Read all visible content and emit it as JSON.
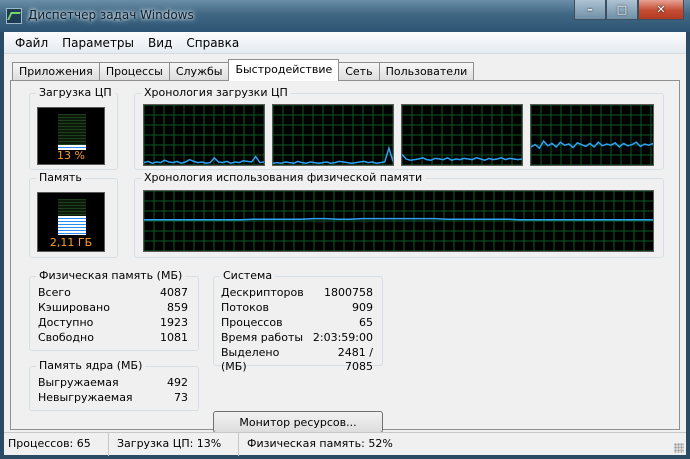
{
  "window": {
    "title": "Диспетчер задач Windows",
    "buttons": {
      "minimize": "–",
      "maximize": "□",
      "close": "✕"
    }
  },
  "menu": [
    "Файл",
    "Параметры",
    "Вид",
    "Справка"
  ],
  "tabs": [
    "Приложения",
    "Процессы",
    "Службы",
    "Быстродействие",
    "Сеть",
    "Пользователи"
  ],
  "active_tab": "Быстродействие",
  "cpu": {
    "label": "Загрузка ЦП",
    "value_text": "13 %",
    "level_percent": 13,
    "history_label": "Хронология загрузки ЦП",
    "history": [
      [
        4,
        6,
        3,
        5,
        4,
        8,
        5,
        4,
        6,
        3,
        5,
        9,
        6,
        4,
        5,
        3,
        4,
        12,
        5,
        4,
        6,
        3,
        5,
        4,
        7,
        6,
        5,
        14,
        4,
        5
      ],
      [
        3,
        4,
        3,
        5,
        4,
        3,
        6,
        4,
        3,
        5,
        4,
        3,
        4,
        5,
        3,
        4,
        6,
        5,
        4,
        3,
        4,
        5,
        6,
        4,
        5,
        3,
        4,
        5,
        28,
        6
      ],
      [
        18,
        10,
        8,
        9,
        10,
        12,
        9,
        8,
        11,
        10,
        9,
        12,
        8,
        10,
        9,
        11,
        10,
        9,
        12,
        10,
        8,
        11,
        9,
        10,
        12,
        9,
        11,
        10,
        9,
        10
      ],
      [
        30,
        34,
        28,
        40,
        32,
        36,
        30,
        38,
        33,
        35,
        29,
        37,
        34,
        31,
        36,
        30,
        38,
        32,
        35,
        33,
        37,
        30,
        36,
        32,
        34,
        38,
        31,
        35,
        33,
        36
      ]
    ],
    "color": "#2fa1f4"
  },
  "memory": {
    "label": "Память",
    "value_text": "2,11 ГБ",
    "level_percent": 52,
    "history_label": "Хронология использования физической памяти",
    "history": [
      52,
      52,
      52,
      52,
      52,
      52,
      52,
      52,
      52,
      53,
      53,
      53,
      53,
      53,
      54,
      54,
      53,
      53,
      54,
      54,
      54,
      54,
      54,
      54,
      54,
      53,
      53,
      53,
      53,
      53,
      53,
      52,
      52,
      52,
      52,
      52,
      52,
      52,
      52,
      52,
      52,
      52,
      52
    ]
  },
  "physical_memory": {
    "label": "Физическая память (МБ)",
    "rows": [
      {
        "name": "Всего",
        "value": "4087"
      },
      {
        "name": "Кэшировано",
        "value": "859"
      },
      {
        "name": "Доступно",
        "value": "1923"
      },
      {
        "name": "Свободно",
        "value": "1081"
      }
    ]
  },
  "kernel_memory": {
    "label": "Память ядра (МБ)",
    "rows": [
      {
        "name": "Выгружаемая",
        "value": "492"
      },
      {
        "name": "Невыгружаемая",
        "value": "73"
      }
    ]
  },
  "system": {
    "label": "Система",
    "rows": [
      {
        "name": "Дескрипторов",
        "value": "1800758"
      },
      {
        "name": "Потоков",
        "value": "909"
      },
      {
        "name": "Процессов",
        "value": "65"
      },
      {
        "name": "Время работы",
        "value": "2:03:59:00"
      },
      {
        "name": "Выделено (МБ)",
        "value": "2481 / 7085"
      }
    ]
  },
  "resource_monitor_button": "Монитор ресурсов...",
  "status": {
    "processes": "Процессов: 65",
    "cpu": "Загрузка ЦП: 13%",
    "memory": "Физическая память: 52%"
  }
}
